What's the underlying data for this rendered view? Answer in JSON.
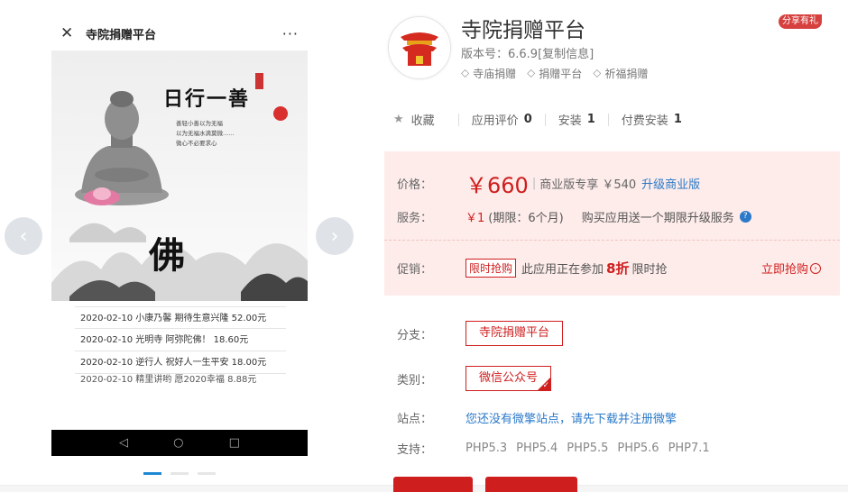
{
  "phone": {
    "close_glyph": "✕",
    "title": "寺院捐赠平台",
    "more_glyph": "···",
    "banner_slogan": "日行一善",
    "banner_poem": [
      "善轻小善以为无福",
      "以为无福水滴莫微......",
      "微心不必要求心"
    ],
    "banner_char": "佛",
    "donations": [
      "2020-02-10 小康乃馨 期待生意兴隆 52.00元",
      "2020-02-10 光明寺 阿弥陀佛！ 18.60元",
      "2020-02-10 逆行人 祝好人一生平安 18.00元",
      "2020-02-10 精里讲哟 愿2020幸福 8.88元"
    ],
    "nav_glyphs": [
      "◁",
      "○",
      "□"
    ]
  },
  "gallery": {
    "prev_glyph": "‹",
    "next_glyph": "›",
    "active_index": 0,
    "dot_count": 3
  },
  "app": {
    "icon_name": "temple-icon",
    "title": "寺院捐赠平台",
    "version": "版本号：6.6.9",
    "copy_info": "[复制信息]",
    "tags": [
      "寺庙捐赠",
      "捐赠平台",
      "祈福捐赠"
    ],
    "share_badge": "分享有礼"
  },
  "stats": {
    "favorite": "收藏",
    "rating_label": "应用评价",
    "rating_value": "0",
    "install_label": "安装",
    "install_value": "1",
    "paid_install_label": "付费安装",
    "paid_install_value": "1"
  },
  "pricing": {
    "price_label": "价格：",
    "price": "￥660",
    "biz_text": "商业版专享 ￥540",
    "upgrade_link": "升级商业版",
    "service_label": "服务：",
    "service_price": "￥1",
    "service_period": "(期限：6个月)",
    "service_desc": "购买应用送一个期限升级服务",
    "help_glyph": "?",
    "promo_label": "促销：",
    "promo_tag": "限时抢购",
    "promo_text_1": "此应用正在参加",
    "promo_discount": "8折",
    "promo_text_2": "限时抢",
    "buy_now": "立即抢购"
  },
  "details": {
    "branch_label": "分支：",
    "branch_value": "寺院捐赠平台",
    "category_label": "类别：",
    "category_value": "微信公众号",
    "site_label": "站点：",
    "site_text": "您还没有微擎站点，请先下载并注册微擎",
    "support_label": "支持：",
    "php_versions": [
      "PHP5.3",
      "PHP5.4",
      "PHP5.5",
      "PHP5.6",
      "PHP7.1"
    ]
  },
  "colors": {
    "accent_red": "#cf1e1e",
    "link_blue": "#2b79c8",
    "price_bg": "#fdecea"
  }
}
